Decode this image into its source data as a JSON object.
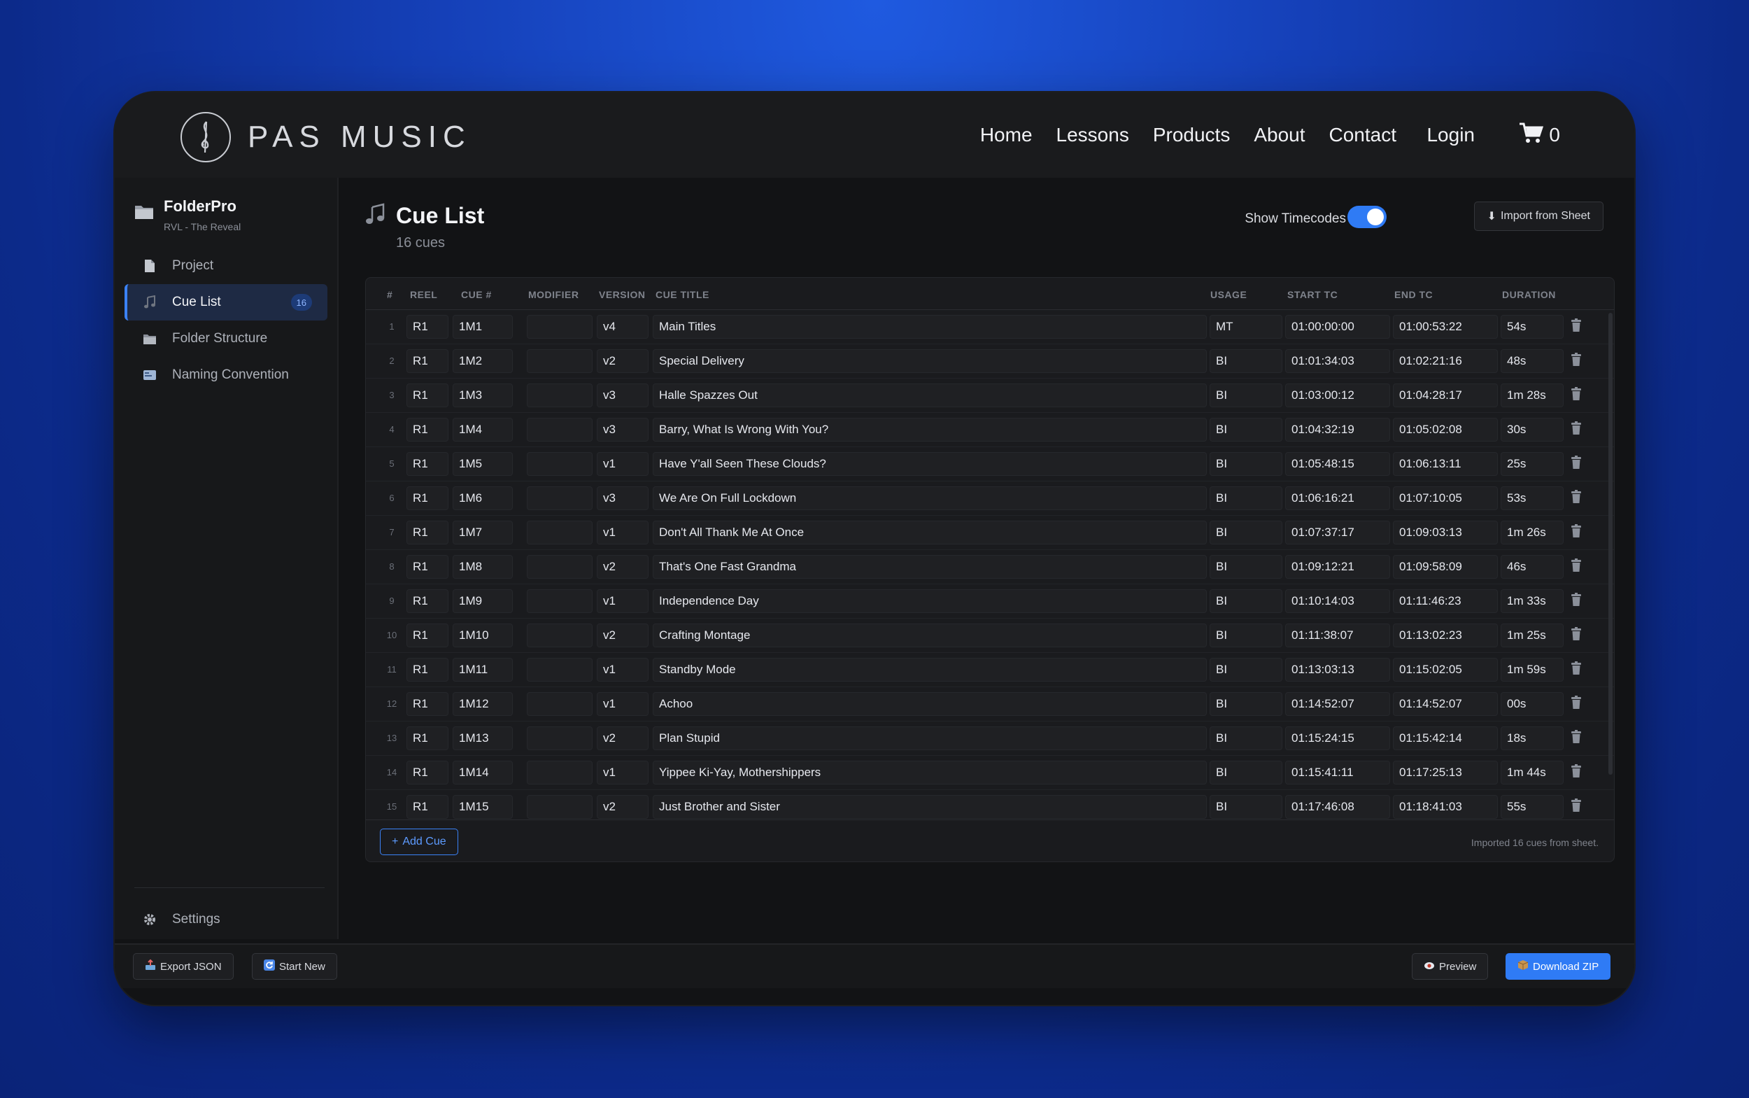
{
  "brand": {
    "name": "PAS MUSIC",
    "logo_icon": "treble-clef-logo"
  },
  "nav": {
    "links": [
      "Home",
      "Lessons",
      "Products",
      "About",
      "Contact"
    ],
    "login": "Login",
    "cart_count": "0"
  },
  "project": {
    "name": "FolderPro",
    "subtitle": "RVL - The Reveal"
  },
  "sidebar": {
    "items": [
      {
        "label": "Project",
        "icon": "document-icon"
      },
      {
        "label": "Cue List",
        "icon": "music-note-icon",
        "badge": "16",
        "active": true
      },
      {
        "label": "Folder Structure",
        "icon": "folder-icon"
      },
      {
        "label": "Naming Convention",
        "icon": "id-card-icon"
      }
    ],
    "settings": "Settings"
  },
  "footer": {
    "export_json": "Export JSON",
    "start_new": "Start New",
    "preview": "Preview",
    "download_zip": "Download ZIP"
  },
  "main": {
    "title": "Cue List",
    "subtitle": "16 cues",
    "show_timecodes_label": "Show Timecodes",
    "show_timecodes_on": true,
    "import_button": "Import from Sheet",
    "add_cue": "Add Cue",
    "imported_note": "Imported 16 cues from sheet."
  },
  "table": {
    "headers": [
      "#",
      "REEL",
      "CUE #",
      "MODIFIER",
      "VERSION",
      "CUE TITLE",
      "USAGE",
      "START TC",
      "END TC",
      "DURATION"
    ],
    "rows": [
      [
        "1",
        "R1",
        "1M1",
        "",
        "v4",
        "Main Titles",
        "MT",
        "01:00:00:00",
        "01:00:53:22",
        "54s"
      ],
      [
        "2",
        "R1",
        "1M2",
        "",
        "v2",
        "Special Delivery",
        "BI",
        "01:01:34:03",
        "01:02:21:16",
        "48s"
      ],
      [
        "3",
        "R1",
        "1M3",
        "",
        "v3",
        "Halle Spazzes Out",
        "BI",
        "01:03:00:12",
        "01:04:28:17",
        "1m 28s"
      ],
      [
        "4",
        "R1",
        "1M4",
        "",
        "v3",
        "Barry, What Is Wrong With You?",
        "BI",
        "01:04:32:19",
        "01:05:02:08",
        "30s"
      ],
      [
        "5",
        "R1",
        "1M5",
        "",
        "v1",
        "Have Y'all Seen These Clouds?",
        "BI",
        "01:05:48:15",
        "01:06:13:11",
        "25s"
      ],
      [
        "6",
        "R1",
        "1M6",
        "",
        "v3",
        "We Are On Full Lockdown",
        "BI",
        "01:06:16:21",
        "01:07:10:05",
        "53s"
      ],
      [
        "7",
        "R1",
        "1M7",
        "",
        "v1",
        "Don't All Thank Me At Once",
        "BI",
        "01:07:37:17",
        "01:09:03:13",
        "1m 26s"
      ],
      [
        "8",
        "R1",
        "1M8",
        "",
        "v2",
        "That's One Fast Grandma",
        "BI",
        "01:09:12:21",
        "01:09:58:09",
        "46s"
      ],
      [
        "9",
        "R1",
        "1M9",
        "",
        "v1",
        "Independence Day",
        "BI",
        "01:10:14:03",
        "01:11:46:23",
        "1m 33s"
      ],
      [
        "10",
        "R1",
        "1M10",
        "",
        "v2",
        "Crafting Montage",
        "BI",
        "01:11:38:07",
        "01:13:02:23",
        "1m 25s"
      ],
      [
        "11",
        "R1",
        "1M11",
        "",
        "v1",
        "Standby Mode",
        "BI",
        "01:13:03:13",
        "01:15:02:05",
        "1m 59s"
      ],
      [
        "12",
        "R1",
        "1M12",
        "",
        "v1",
        "Achoo",
        "BI",
        "01:14:52:07",
        "01:14:52:07",
        "00s"
      ],
      [
        "13",
        "R1",
        "1M13",
        "",
        "v2",
        "Plan Stupid",
        "BI",
        "01:15:24:15",
        "01:15:42:14",
        "18s"
      ],
      [
        "14",
        "R1",
        "1M14",
        "",
        "v1",
        "Yippee Ki-Yay, Mothershippers",
        "BI",
        "01:15:41:11",
        "01:17:25:13",
        "1m 44s"
      ],
      [
        "15",
        "R1",
        "1M15",
        "",
        "v2",
        "Just Brother and Sister",
        "BI",
        "01:17:46:08",
        "01:18:41:03",
        "55s"
      ]
    ]
  },
  "colors": {
    "accent": "#2f7bf5",
    "background": "#121315",
    "page_gradient": "#1540b8"
  }
}
